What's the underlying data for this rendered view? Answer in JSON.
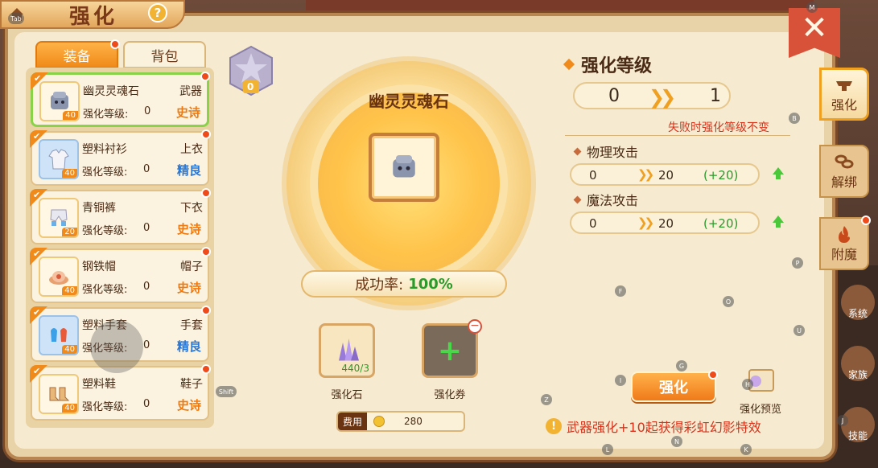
{
  "window": {
    "title": "强化",
    "help_icon": "?"
  },
  "left_tabs": [
    {
      "label": "装备",
      "active": true
    },
    {
      "label": "背包",
      "active": false
    }
  ],
  "equipment": [
    {
      "name": "幽灵灵魂石",
      "slot": "武器",
      "level_label": "强化等级:",
      "level": "0",
      "quality": "史诗",
      "quality_color": "orange",
      "item_level": "40",
      "selected": true,
      "icon": "soul-stone-icon"
    },
    {
      "name": "塑料衬衫",
      "slot": "上衣",
      "level_label": "强化等级:",
      "level": "0",
      "quality": "精良",
      "quality_color": "blue",
      "item_level": "40",
      "selected": false,
      "icon": "shirt-icon"
    },
    {
      "name": "青铜裤",
      "slot": "下衣",
      "level_label": "强化等级:",
      "level": "0",
      "quality": "史诗",
      "quality_color": "orange",
      "item_level": "20",
      "selected": false,
      "icon": "pants-icon"
    },
    {
      "name": "钢铁帽",
      "slot": "帽子",
      "level_label": "强化等级:",
      "level": "0",
      "quality": "史诗",
      "quality_color": "orange",
      "item_level": "40",
      "selected": false,
      "icon": "hat-icon"
    },
    {
      "name": "塑料手套",
      "slot": "手套",
      "level_label": "强化等级:",
      "level": "0",
      "quality": "精良",
      "quality_color": "blue",
      "item_level": "40",
      "selected": false,
      "icon": "gloves-icon"
    },
    {
      "name": "塑料鞋",
      "slot": "鞋子",
      "level_label": "强化等级:",
      "level": "0",
      "quality": "史诗",
      "quality_color": "orange",
      "item_level": "40",
      "selected": false,
      "icon": "shoes-icon"
    }
  ],
  "center": {
    "star_level": "0",
    "item_name": "幽灵灵魂石",
    "success_label": "成功率:",
    "success_value": "100%",
    "materials": [
      {
        "label": "强化石",
        "count": "440/3"
      },
      {
        "label": "强化券",
        "count": ""
      }
    ],
    "cost_label": "费用",
    "cost_value": "280"
  },
  "right": {
    "title": "强化等级",
    "level_from": "0",
    "level_to": "1",
    "fail_note": "失败时强化等级不变",
    "stats": [
      {
        "name": "物理攻击",
        "from": "0",
        "to": "20",
        "delta": "(+20)"
      },
      {
        "name": "魔法攻击",
        "from": "0",
        "to": "20",
        "delta": "(+20)"
      }
    ],
    "enhance_button": "强化",
    "preview_label": "强化预览",
    "notice": "武器强化+10起获得彩虹幻影特效"
  },
  "side_tabs": [
    {
      "label": "强化",
      "active": true
    },
    {
      "label": "解绑",
      "active": false
    },
    {
      "label": "附魔",
      "active": false
    }
  ],
  "background_sidebar": [
    "系统",
    "家族",
    "技能"
  ],
  "key_hints": [
    "M",
    "B",
    "P",
    "F",
    "O",
    "U",
    "G",
    "I",
    "H",
    "Z",
    "L",
    "N",
    "K",
    "J",
    "Shift",
    "Tab"
  ],
  "colors": {
    "accent": "#f08a1a",
    "epic": "#f07a10",
    "rare": "#2a78d8",
    "positive": "#2a9a2a",
    "warning": "#d8321a"
  }
}
